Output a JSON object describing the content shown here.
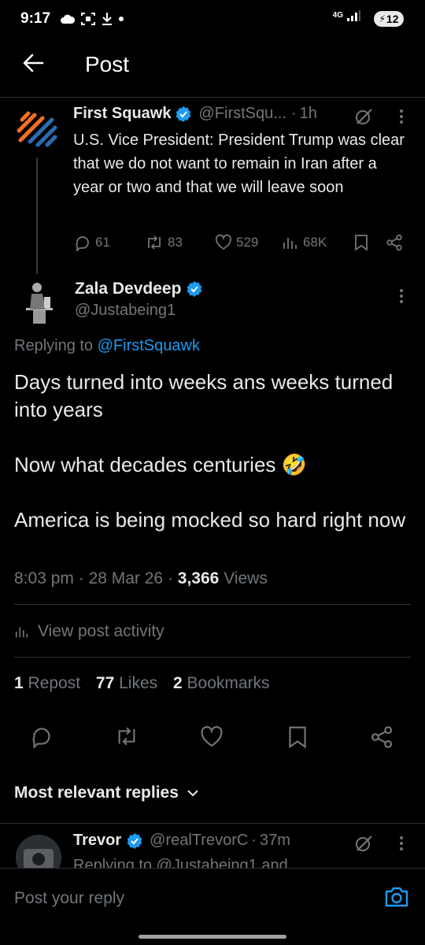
{
  "status_bar": {
    "time": "9:17",
    "network": "4G",
    "battery": "12"
  },
  "header": {
    "title": "Post"
  },
  "parent_post": {
    "author_name": "First Squawk",
    "author_handle": "@FirstSqu...",
    "separator": "·",
    "time": "1h",
    "text": "U.S. Vice President: President Trump was clear that we do not want to remain in Iran after a year or two and that we will leave soon",
    "replies": "61",
    "reposts": "83",
    "likes": "529",
    "views": "68K"
  },
  "main_post": {
    "author_name": "Zala Devdeep",
    "author_handle": "@Justabeing1",
    "replying_to_label": "Replying to",
    "replying_to_handle": "@FirstSquawk",
    "paragraph_1": "Days turned into weeks ans weeks turned into years",
    "paragraph_2": "Now what decades centuries 🤣",
    "paragraph_3": "America is being mocked so hard right now",
    "time": "8:03 pm",
    "date": "28 Mar 26",
    "views_count": "3,366",
    "views_label": "Views",
    "view_activity": "View post activity",
    "reposts_count": "1",
    "reposts_label": "Repost",
    "likes_count": "77",
    "likes_label": "Likes",
    "bookmarks_count": "2",
    "bookmarks_label": "Bookmarks"
  },
  "replies_section": {
    "sort_label": "Most relevant replies"
  },
  "reply_preview": {
    "author_name": "Trevor",
    "author_handle": "@realTrevorC",
    "time": "37m",
    "text": "Replying to @Justabeing1 and"
  },
  "composer": {
    "placeholder": "Post your reply"
  },
  "colors": {
    "background": "#000000",
    "text": "#e7e9ea",
    "muted": "#71767b",
    "accent": "#1d9bf0",
    "divider": "#2f3336"
  },
  "icons": [
    "back-arrow-icon",
    "verified-badge-icon",
    "grok-icon",
    "more-icon",
    "reply-icon",
    "repost-icon",
    "like-icon",
    "views-icon",
    "bookmark-icon",
    "share-icon",
    "chevron-down-icon",
    "camera-icon"
  ]
}
